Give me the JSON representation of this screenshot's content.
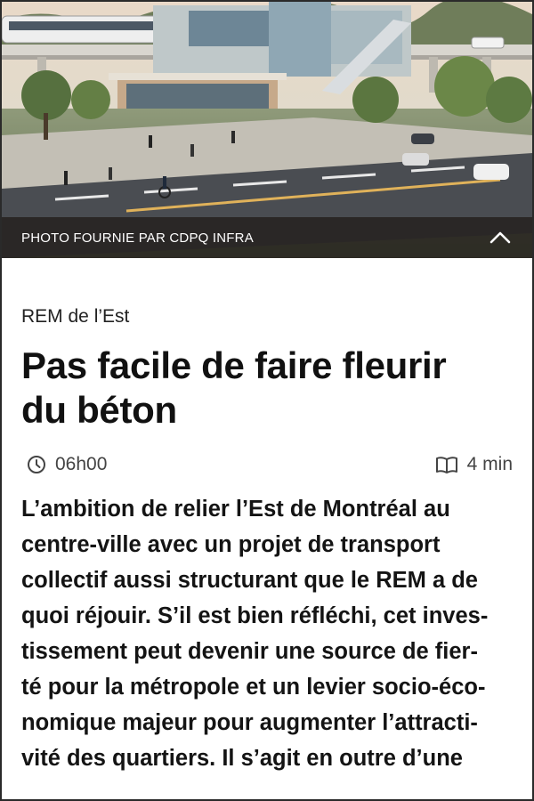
{
  "hero": {
    "caption": "PHOTO FOURNIE PAR CDPQ INFRA",
    "toggle_icon": "chevron-up-icon"
  },
  "article": {
    "section": "REM de l’Est",
    "headline_lines": [
      "Pas facile de faire fleurir",
      "du béton"
    ],
    "time": "06h00",
    "time_icon": "clock-icon",
    "read_time": "4 min",
    "read_icon": "book-icon",
    "lead_lines": [
      "L’ambition de relier l’Est de Montréal au",
      "centre-ville avec un projet de transport",
      "collectif aussi structurant que le REM a de",
      "quoi réjouir. S’il est bien réfléchi, cet inves-",
      "tissement peut devenir une source de fier-",
      "té pour la métropole et un levier socio-éco-",
      "nomique majeur pour augmenter l’attracti-",
      "vité des quartiers. Il s’agit en outre d’une"
    ]
  }
}
